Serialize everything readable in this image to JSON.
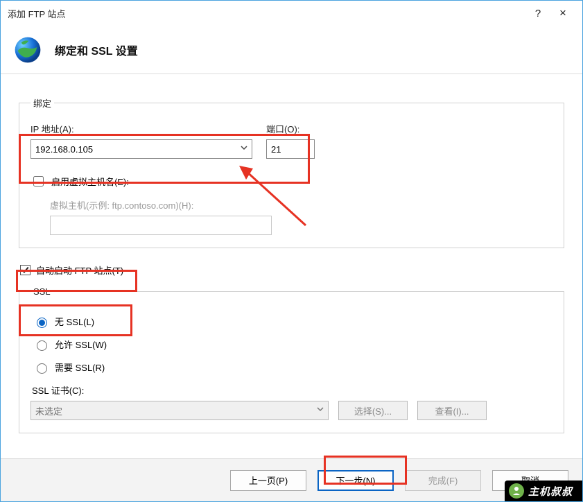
{
  "window": {
    "title": "添加 FTP 站点",
    "help": "?",
    "close": "×"
  },
  "header": {
    "title": "绑定和 SSL 设置"
  },
  "binding": {
    "legend": "绑定",
    "ip_label": "IP 地址(A):",
    "ip_value": "192.168.0.105",
    "port_label": "端口(O):",
    "port_value": "21",
    "enable_vhost_label": "启用虚拟主机名(E):",
    "vhost_label": "虚拟主机(示例: ftp.contoso.com)(H):"
  },
  "autostart": {
    "label": "自动启动 FTP 站点(T)"
  },
  "ssl": {
    "legend": "SSL",
    "opt_none": "无 SSL(L)",
    "opt_allow": "允许 SSL(W)",
    "opt_require": "需要 SSL(R)",
    "cert_label": "SSL 证书(C):",
    "cert_value": "未选定",
    "select_btn": "选择(S)...",
    "view_btn": "查看(I)..."
  },
  "footer": {
    "prev": "上一页(P)",
    "next": "下一步(N)",
    "finish": "完成(F)",
    "cancel": "取消"
  },
  "badge": {
    "text": "主机叔叔"
  }
}
